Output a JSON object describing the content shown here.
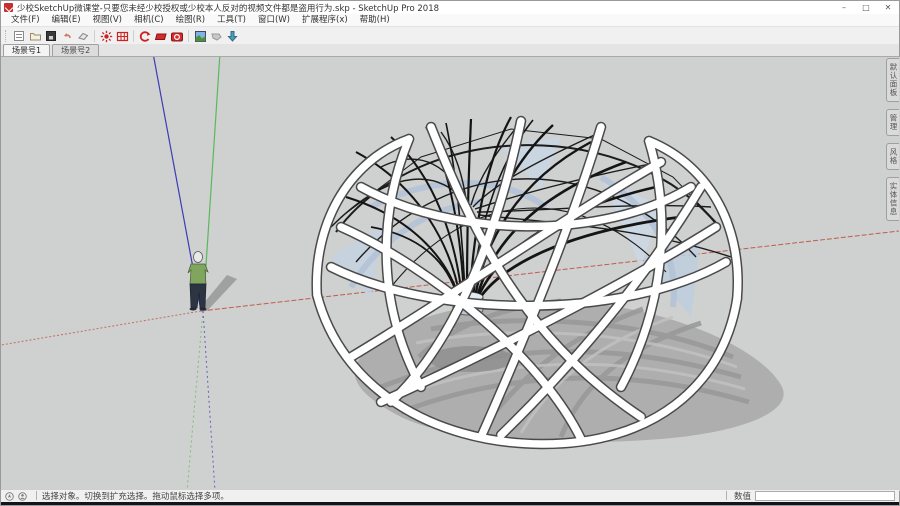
{
  "window": {
    "title": "少校SketchUp微课堂-只要您未经少校授权或少校本人反对的视频文件都是盗用行为.skp - SketchUp Pro 2018",
    "controls": {
      "minimize": "–",
      "maximize": "□",
      "close": "✕"
    }
  },
  "menubar": {
    "items": [
      {
        "label": "文件(F)"
      },
      {
        "label": "编辑(E)"
      },
      {
        "label": "视图(V)"
      },
      {
        "label": "相机(C)"
      },
      {
        "label": "绘图(R)"
      },
      {
        "label": "工具(T)"
      },
      {
        "label": "窗口(W)"
      },
      {
        "label": "扩展程序(x)"
      },
      {
        "label": "帮助(H)"
      }
    ]
  },
  "toolbar": {
    "icons": [
      "new-document-icon",
      "open-folder-icon",
      "save-icon",
      "undo-icon",
      "eraser-icon",
      "red-sun-plugin-icon",
      "red-grid-plugin-icon",
      "red-rotate-plugin-icon",
      "red-flag-plugin-icon",
      "red-camera-plugin-icon",
      "scene-image-plugin-icon",
      "gray-arrow-plugin-icon",
      "export-down-plugin-icon"
    ]
  },
  "scene_tabs": [
    {
      "label": "场景号1",
      "selected": true
    },
    {
      "label": "场景号2",
      "selected": false
    }
  ],
  "tray_tabs": [
    {
      "label": "默认面板"
    },
    {
      "label": "管理"
    },
    {
      "label": "风格"
    },
    {
      "label": "实体信息"
    }
  ],
  "statusbar": {
    "message": "选择对象。切换到扩充选择。拖动鼠标选择多项。",
    "measure_label": "数值",
    "measure_value": ""
  },
  "colors": {
    "axis_red": "#c0564a",
    "axis_green": "#5cb85c",
    "axis_blue": "#3c3cb4",
    "viewport_bg": "#cfd0d0",
    "plugin_red": "#cc2222"
  }
}
